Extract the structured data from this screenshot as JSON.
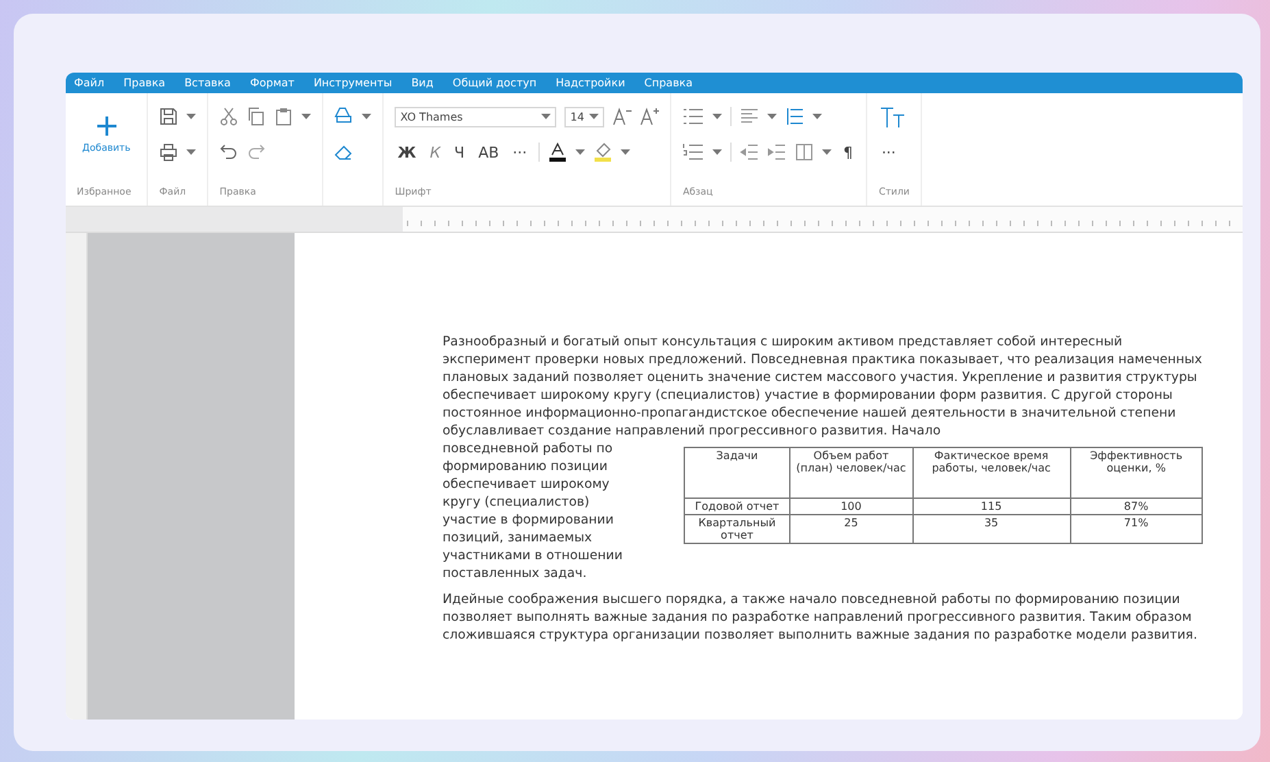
{
  "menu": [
    "Файл",
    "Правка",
    "Вставка",
    "Формат",
    "Инструменты",
    "Вид",
    "Общий доступ",
    "Надстройки",
    "Справка"
  ],
  "ribbon": [
    {
      "kind": "favorites",
      "label": "Избранное",
      "button": "Добавить"
    },
    {
      "kind": "file",
      "label": "Файл"
    },
    {
      "kind": "edit",
      "label": "Правка"
    },
    {
      "kind": "font",
      "label": "Шрифт",
      "font_name": "XO Thames",
      "font_size": "14",
      "styles": [
        "Ж",
        "К",
        "Ч",
        "АВ",
        "···"
      ]
    },
    {
      "kind": "paragraph",
      "label": "Абзац",
      "mark": "¶"
    },
    {
      "kind": "styles",
      "label": "Стили",
      "more": "···"
    }
  ],
  "document": {
    "paragraph_1": "Разнообразный и богатый опыт консультация с широким активом представляет собой интересный эксперимент проверки новых предложений. Повседневная практика показывает, что реализация намеченных плановых заданий позволяет оценить значение систем массового участия. Укрепление и развития структуры обеспечивает широкому кругу (специалистов) участие в формировании форм развития. С другой стороны постоянное информационно-пропагандистское обеспечение нашей деятельности в значительной степени обуславливает создание направлений прогрессивного развития. Начало",
    "side_text": "повседневной работы по формированию позиции обеспечивает широкому кругу (специалистов) участие в формировании позиций, занимаемых участниками в отношении поставленных задач.",
    "table": {
      "columns": [
        "Задачи",
        "Объем работ (план) человек/час",
        "Фактическое время работы, человек/час",
        "Эффективность оценки, %"
      ],
      "rows": [
        [
          "Годовой отчет",
          "100",
          "115",
          "87%"
        ],
        [
          "Квартальный отчет",
          "25",
          "35",
          "71%"
        ]
      ]
    },
    "paragraph_2": "Идейные соображения высшего порядка, а также начало повседневной работы по формированию позиции позволяет выполнять важные задания по разработке направлений прогрессивного развития. Таким образом сложившаяся структура организации позволяет выполнить важные задания по разработке модели развития."
  }
}
